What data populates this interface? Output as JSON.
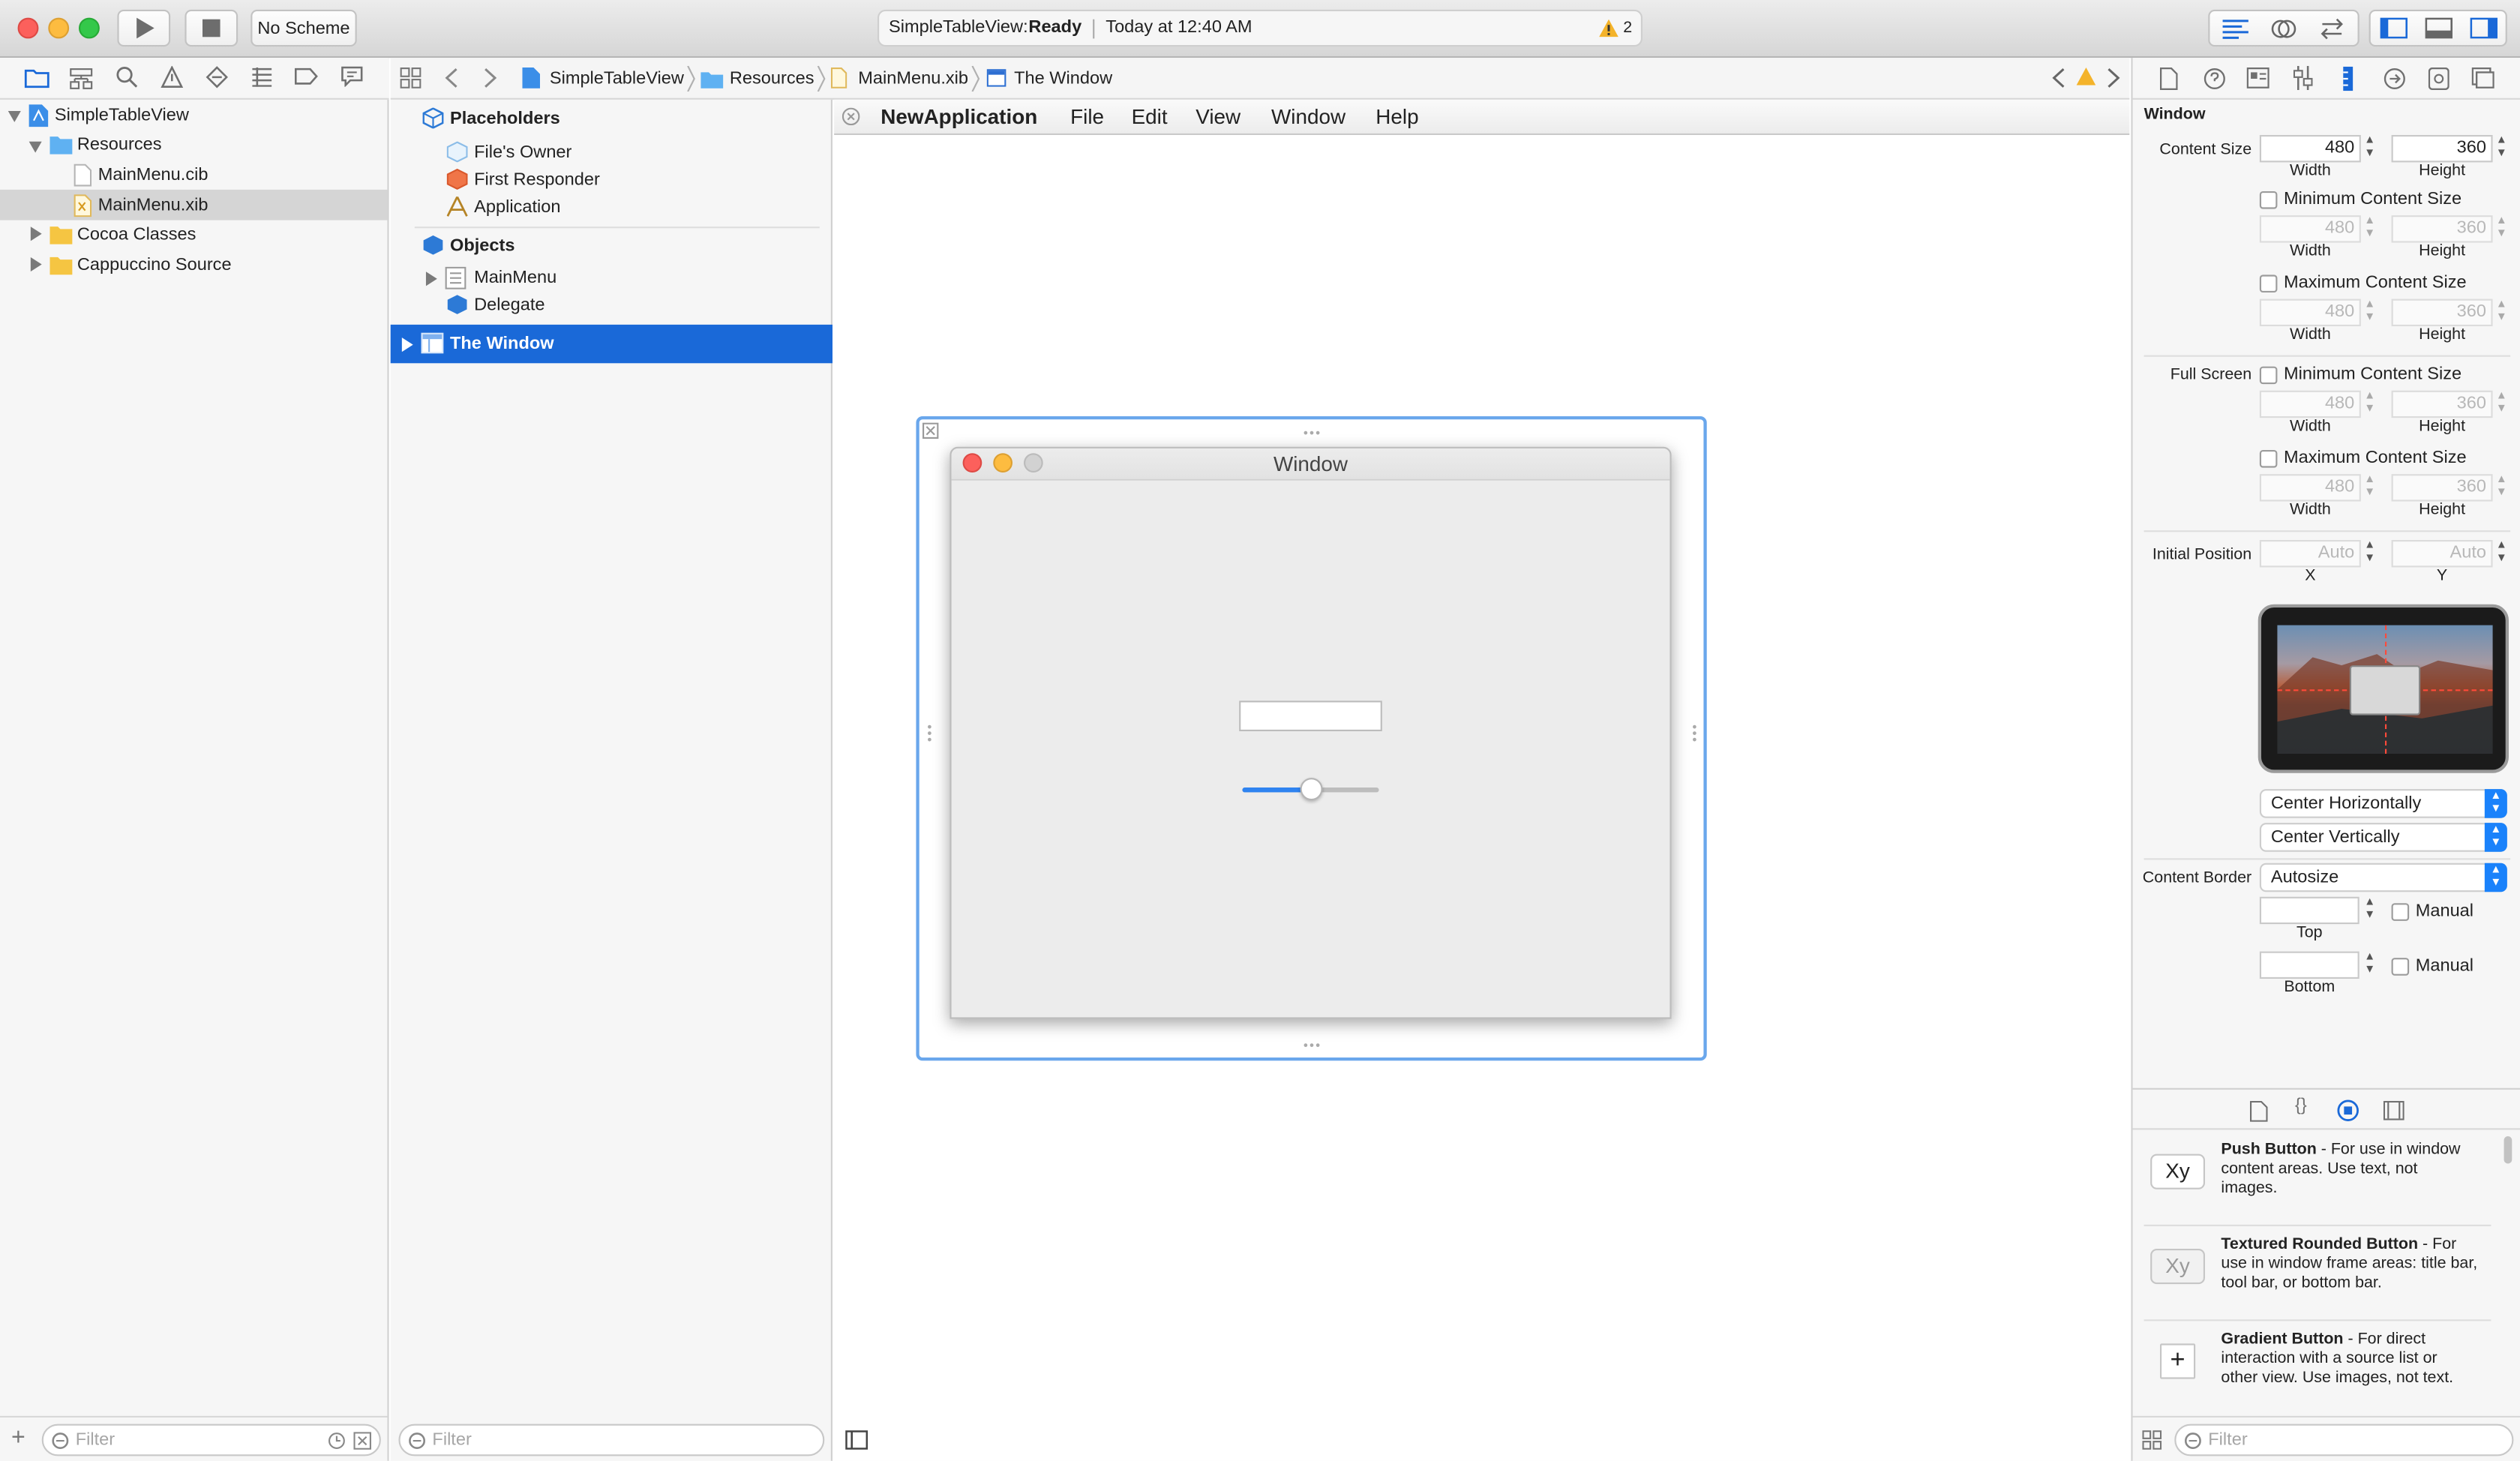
{
  "toolbar": {
    "scheme": "No Scheme",
    "activity_project": "SimpleTableView:",
    "activity_status": "Ready",
    "activity_time": "Today at 12:40 AM",
    "warning_count": "2"
  },
  "navigator": {
    "items": [
      {
        "label": "SimpleTableView"
      },
      {
        "label": "Resources"
      },
      {
        "label": "MainMenu.cib"
      },
      {
        "label": "MainMenu.xib"
      },
      {
        "label": "Cocoa Classes"
      },
      {
        "label": "Cappuccino Source"
      }
    ],
    "filter_placeholder": "Filter"
  },
  "breadcrumb": [
    "SimpleTableView",
    "Resources",
    "MainMenu.xib",
    "The Window"
  ],
  "outline": {
    "placeholders_header": "Placeholders",
    "placeholders": [
      "File's Owner",
      "First Responder",
      "Application"
    ],
    "objects_header": "Objects",
    "objects": [
      "MainMenu",
      "Delegate"
    ],
    "selected": "The Window",
    "filter_placeholder": "Filter"
  },
  "canvas": {
    "menubar": [
      "NewApplication",
      "File",
      "Edit",
      "View",
      "Window",
      "Help"
    ],
    "window_title": "Window",
    "slider_value": 0.5
  },
  "inspector": {
    "section_title": "Window",
    "content_size_label": "Content Size",
    "width": "480",
    "height": "360",
    "width_label": "Width",
    "height_label": "Height",
    "min_content_size": "Minimum Content Size",
    "max_content_size": "Maximum Content Size",
    "min_w": "480",
    "min_h": "360",
    "max_w": "480",
    "max_h": "360",
    "full_screen_label": "Full Screen",
    "fs_min_w": "480",
    "fs_min_h": "360",
    "fs_max_w": "480",
    "fs_max_h": "360",
    "initial_position_label": "Initial Position",
    "pos_x": "Auto",
    "pos_y": "Auto",
    "x_label": "X",
    "y_label": "Y",
    "horizontal": "Center Horizontally",
    "vertical": "Center Vertically",
    "content_border_label": "Content Border",
    "content_border": "Autosize",
    "manual": "Manual",
    "top_label": "Top",
    "bottom_label": "Bottom"
  },
  "library": {
    "items": [
      {
        "title": "Push Button",
        "desc": " - For use in window content areas. Use text, not images.",
        "icon": "Xy"
      },
      {
        "title": "Textured Rounded Button",
        "desc": " - For use in window frame areas: title bar, tool bar, or bottom bar.",
        "icon": "Xy"
      },
      {
        "title": "Gradient Button",
        "desc": " - For direct interaction with a source list or other view. Use images, not text.",
        "icon": "+"
      }
    ],
    "filter_placeholder": "Filter"
  },
  "colors": {
    "accent": "#1a69d8",
    "selection": "#1a69d8",
    "close": "#fc605c",
    "minimize": "#fdbc40"
  }
}
